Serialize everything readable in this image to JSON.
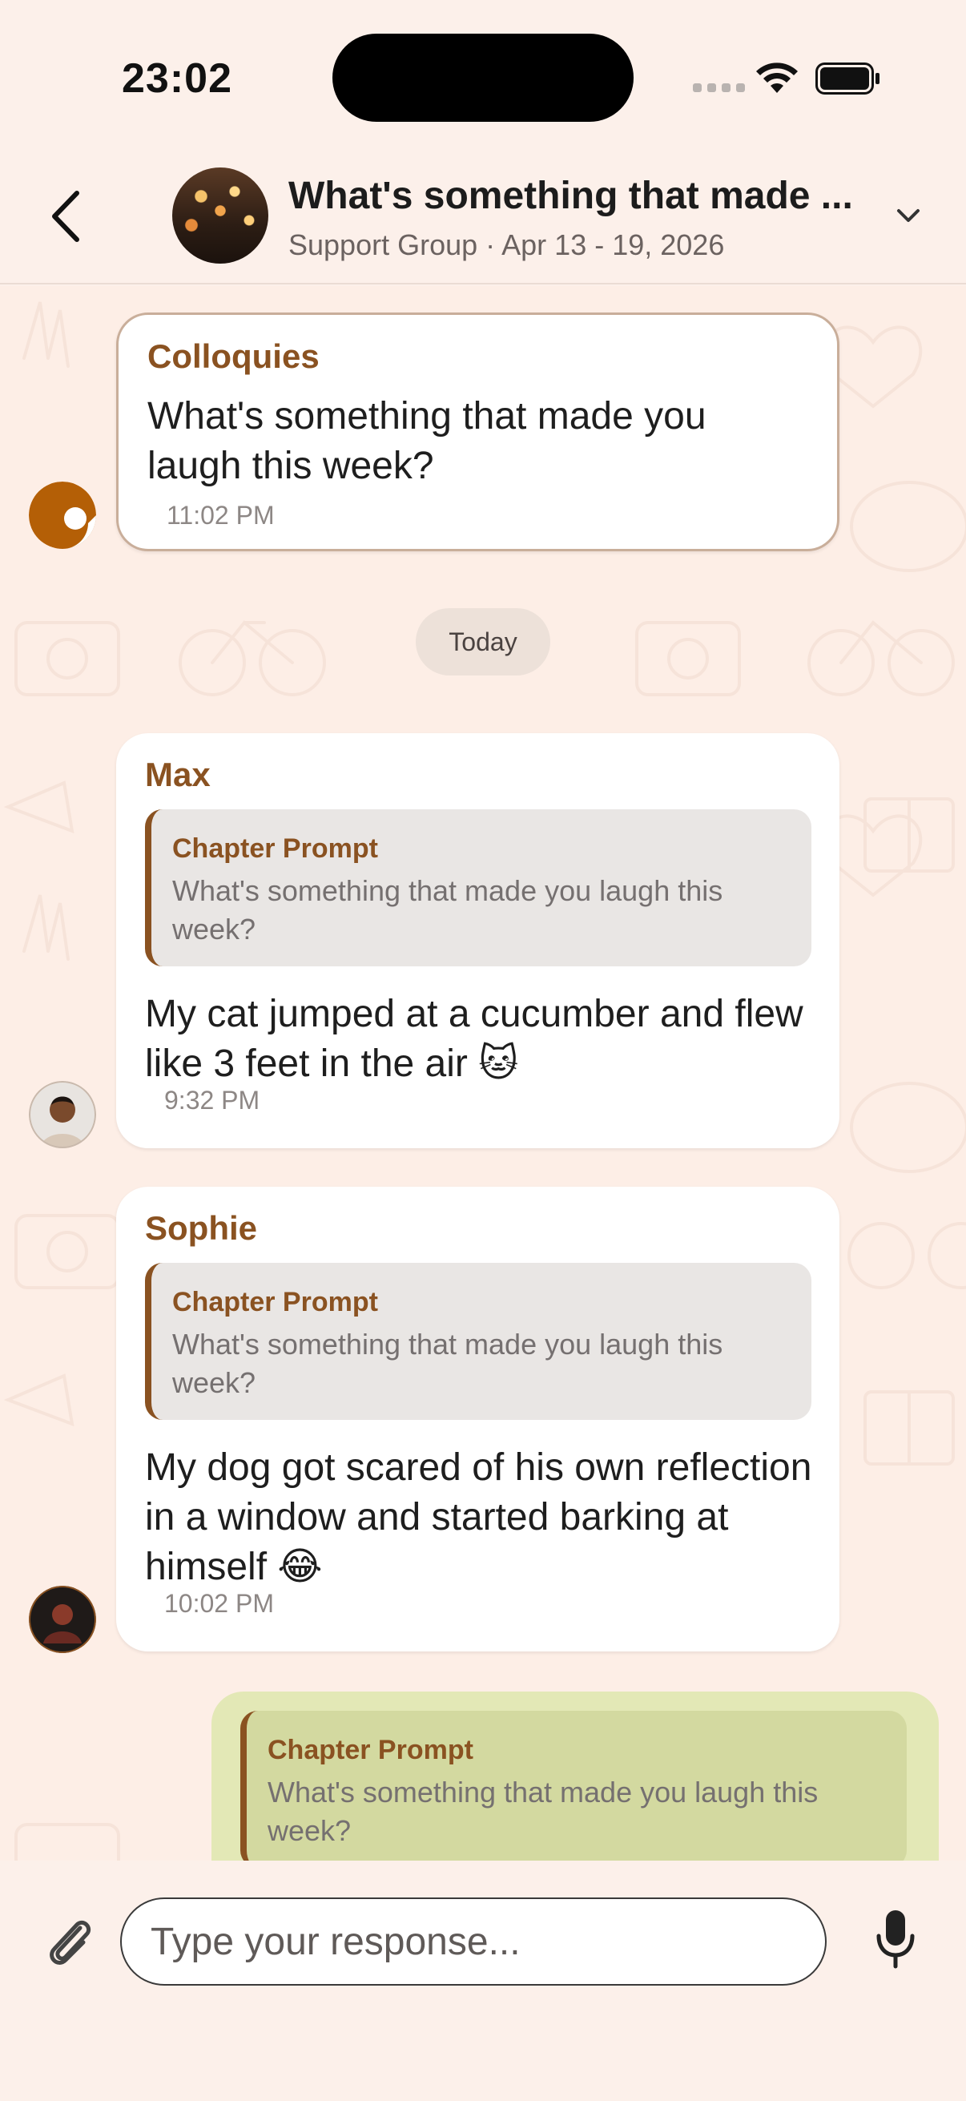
{
  "status": {
    "time": "23:02"
  },
  "header": {
    "title": "What's something that made ...",
    "subtitle": "Support Group · Apr 13 - 19, 2026"
  },
  "messages": [
    {
      "sender": "Colloquies",
      "text": "What's something that made you laugh this week?",
      "time": "11:02 PM"
    },
    {
      "sender": "Max",
      "quote_title": "Chapter Prompt",
      "quote_text": "What's something that made you laugh this week?",
      "text": "My cat jumped at a cucumber and flew like 3 feet in the air 🐱",
      "time": "9:32 PM"
    },
    {
      "sender": "Sophie",
      "quote_title": "Chapter Prompt",
      "quote_text": "What's something that made you laugh this week?",
      "text": "My dog got scared of his own reflection in a window and started barking at himself 😂",
      "time": "10:02 PM"
    }
  ],
  "date_divider": "Today",
  "own_message": {
    "quote_title": "Chapter Prompt",
    "quote_text": "What's something that made you laugh this week?"
  },
  "composer": {
    "placeholder": "Type your response..."
  },
  "colors": {
    "background": "#fcf0ea",
    "accent": "#8a5221",
    "own_bubble": "#e3e8b6"
  }
}
